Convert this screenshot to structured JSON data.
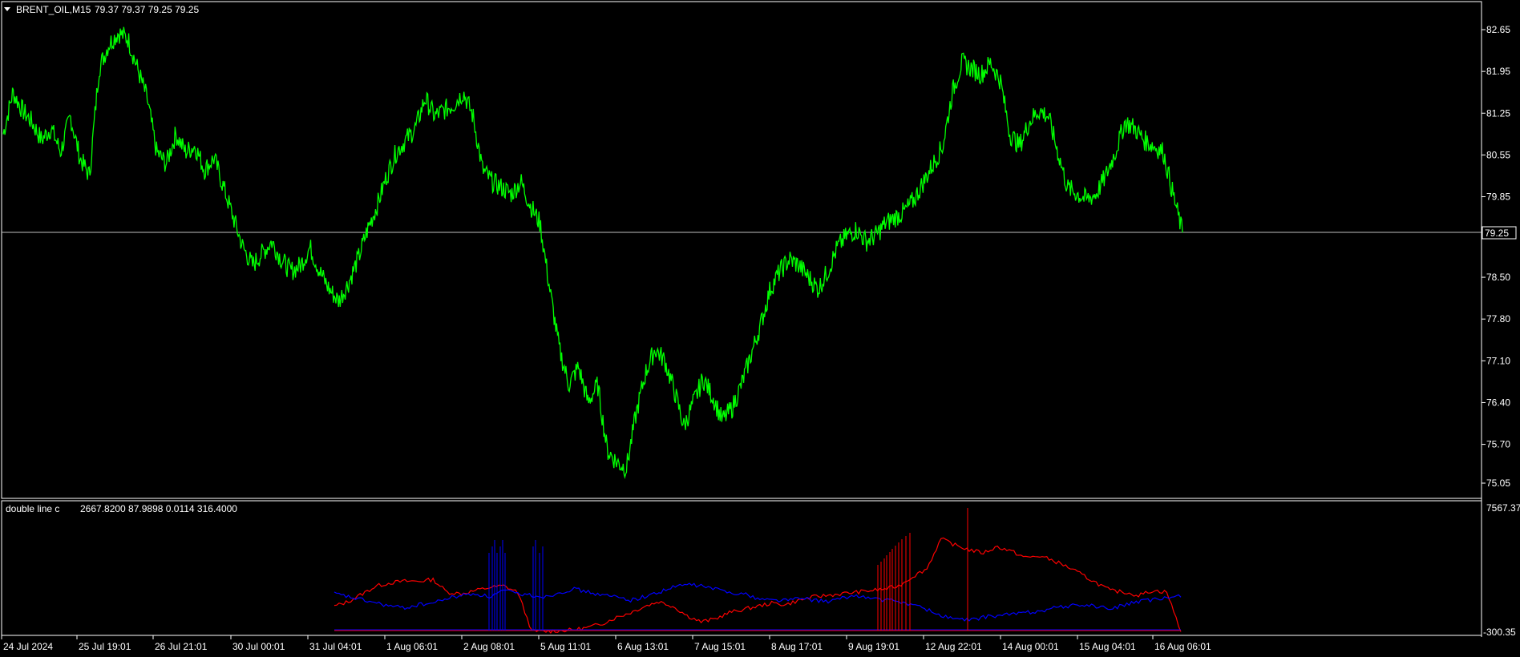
{
  "header": {
    "symbol": "BRENT_OIL,M15",
    "ohlc": "79.37 79.37 79.25 79.25",
    "menu_icon": "triangle-down-icon"
  },
  "price_axis": {
    "labels": [
      "82.65",
      "81.95",
      "81.25",
      "80.55",
      "79.85",
      "78.50",
      "77.80",
      "77.10",
      "76.40",
      "75.70",
      "75.05"
    ],
    "current_price": "79.25"
  },
  "indicator": {
    "title": "double line c",
    "values": "2667.8200 87.9898 0.0114 316.4000",
    "axis_labels": [
      "7567.37",
      "-300.35"
    ]
  },
  "time_axis": {
    "labels": [
      "24 Jul 2024",
      "25 Jul 19:01",
      "26 Jul 21:01",
      "30 Jul 00:01",
      "31 Jul 04:01",
      "1 Aug 06:01",
      "2 Aug 08:01",
      "5 Aug 11:01",
      "6 Aug 13:01",
      "7 Aug 15:01",
      "8 Aug 17:01",
      "9 Aug 19:01",
      "12 Aug 22:01",
      "14 Aug 00:01",
      "15 Aug 04:01",
      "16 Aug 06:01"
    ]
  },
  "colors": {
    "background": "#000000",
    "price_line": "#00ff00",
    "indicator_red": "#ff0000",
    "indicator_blue": "#0000ff",
    "grid_text": "#ffffff"
  },
  "chart_data": {
    "type": "line",
    "series": [
      {
        "values": [
          80.9,
          81.6,
          81.3,
          81.1,
          80.8,
          81.0,
          80.6,
          81.2,
          80.5,
          80.2,
          82.0,
          82.4,
          82.6,
          82.5,
          82.0,
          81.5,
          80.6,
          80.4,
          80.9,
          80.6,
          80.7,
          80.3,
          80.5,
          80.0,
          79.5,
          79.0,
          78.7,
          78.9,
          79.1,
          78.8,
          78.6,
          78.7,
          79.0,
          78.6,
          78.3,
          78.1,
          78.4,
          78.8,
          79.3,
          79.7,
          80.2,
          80.6,
          80.8,
          81.0,
          81.5,
          81.2,
          81.3,
          81.4,
          81.6,
          81.2,
          80.3,
          80.1,
          80.0,
          79.9,
          80.1,
          79.7,
          79.4,
          78.3,
          77.3,
          76.7,
          77.0,
          76.4,
          76.7,
          75.6,
          75.4,
          75.3,
          76.2,
          76.9,
          77.3,
          77.1,
          76.6,
          76.0,
          76.4,
          76.8,
          76.5,
          76.1,
          76.3,
          76.7,
          77.2,
          77.7,
          78.3,
          78.6,
          78.8,
          78.7,
          78.5,
          78.3,
          78.6,
          79.0,
          79.2,
          79.3,
          79.1,
          79.2,
          79.4,
          79.5,
          79.6,
          79.8,
          80.1,
          80.4,
          80.7,
          81.6,
          82.1,
          82.0,
          81.9,
          82.1,
          81.8,
          80.9,
          80.7,
          81.1,
          81.3,
          81.2,
          80.6,
          80.0,
          79.9,
          79.8,
          79.9,
          80.2,
          80.6,
          81.1,
          81.0,
          80.8,
          80.7,
          80.6,
          79.9,
          79.25
        ]
      }
    ]
  },
  "indicator_data": {
    "type": "line",
    "series": [
      {
        "color": "red",
        "values": [
          1300,
          1600,
          2100,
          2600,
          2800,
          2900,
          2900,
          3000,
          2200,
          2100,
          2300,
          2500,
          2600,
          2200,
          -300,
          -300,
          -250,
          -200,
          -50,
          200,
          600,
          900,
          1300,
          1600,
          1300,
          700,
          300,
          500,
          900,
          1100,
          1300,
          1500,
          1400,
          1700,
          1900,
          2000,
          2100,
          2200,
          2300,
          2400,
          2600,
          3200,
          3700,
          5600,
          5200,
          4900,
          4700,
          5100,
          4800,
          4400,
          4500,
          4200,
          3800,
          3300,
          2800,
          2300,
          2200,
          2000,
          2300,
          2200,
          -300
        ]
      },
      {
        "color": "blue",
        "values": [
          2100,
          1900,
          1700,
          1500,
          1300,
          1200,
          1400,
          1500,
          1800,
          2000,
          2100,
          1900,
          2300,
          2100,
          2000,
          1900,
          2200,
          2400,
          2200,
          2000,
          1900,
          1700,
          1900,
          2200,
          2500,
          2700,
          2600,
          2400,
          2200,
          2100,
          1800,
          1700,
          1700,
          1800,
          1700,
          1600,
          1800,
          2000,
          1800,
          1700,
          1600,
          1400,
          1100,
          700,
          500,
          400,
          600,
          700,
          800,
          900,
          1000,
          1200,
          1300,
          1400,
          1300,
          1100,
          1400,
          1600,
          1700,
          1800,
          2000
        ]
      }
    ],
    "spikes_blue_label": "blue spikes near 2 Aug",
    "spikes_red_label": "red spikes near 9-12 Aug"
  }
}
